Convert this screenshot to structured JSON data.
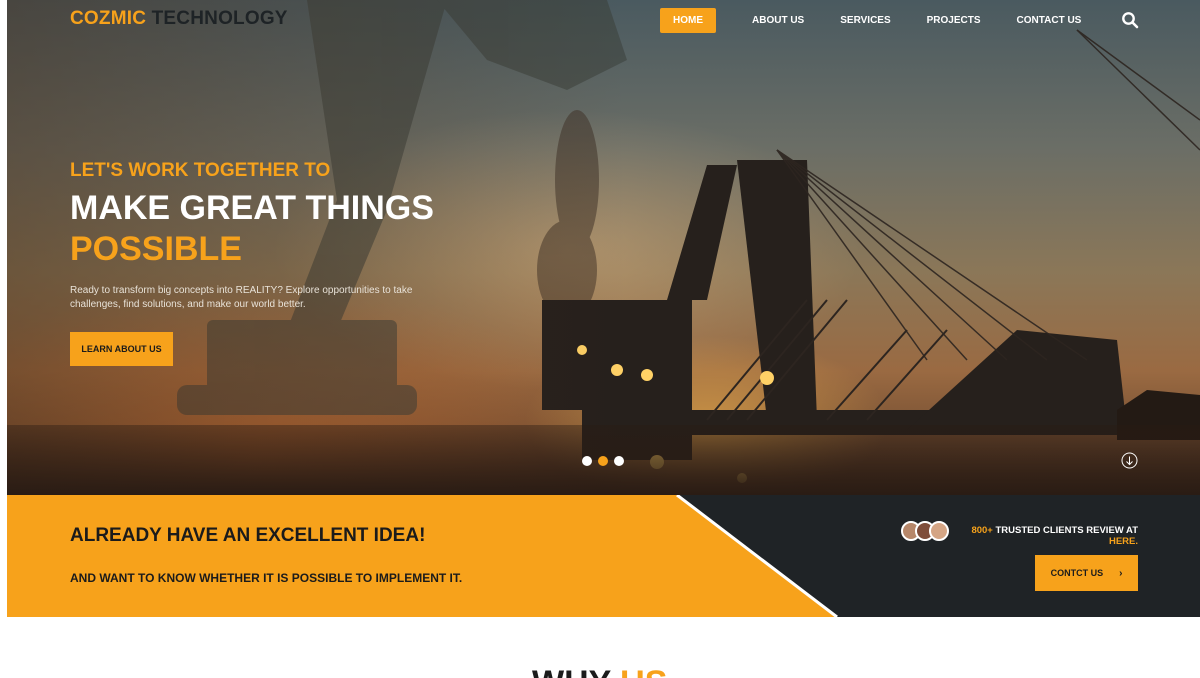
{
  "brand": {
    "part1": "COZMIC",
    "part2": "TECHNOLOGY"
  },
  "nav": {
    "items": [
      {
        "label": "HOME",
        "active": true
      },
      {
        "label": "ABOUT US",
        "active": false
      },
      {
        "label": "SERVICES",
        "active": false
      },
      {
        "label": "PROJECTS",
        "active": false
      },
      {
        "label": "CONTACT US",
        "active": false
      }
    ],
    "search_icon": "search-icon"
  },
  "hero": {
    "kicker": "LET'S WORK TOGETHER TO",
    "headline_line1": "MAKE GREAT THINGS",
    "headline_line2": "POSSIBLE",
    "lead": "Ready to transform big concepts into REALITY? Explore opportunities to take challenges, find solutions, and make our world better.",
    "button_label": "LEARN ABOUT US",
    "slides": {
      "count": 3,
      "active_index": 1
    },
    "scroll_icon": "scroll-down-icon"
  },
  "cta": {
    "title": "ALREADY HAVE AN EXCELLENT IDEA!",
    "subtitle": "AND WANT TO KNOW WHETHER IT IS POSSIBLE TO IMPLEMENT IT.",
    "clients_count": "800+",
    "clients_text": "TRUSTED CLIENTS REVIEW AT",
    "clients_link": "HERE.",
    "button_label": "CONTCT US",
    "button_icon": "chevron-right-icon"
  },
  "section_next": {
    "word1": "WHY",
    "word2": "US"
  },
  "colors": {
    "accent": "#f7a21b",
    "dark": "#1f2326",
    "white": "#ffffff"
  }
}
